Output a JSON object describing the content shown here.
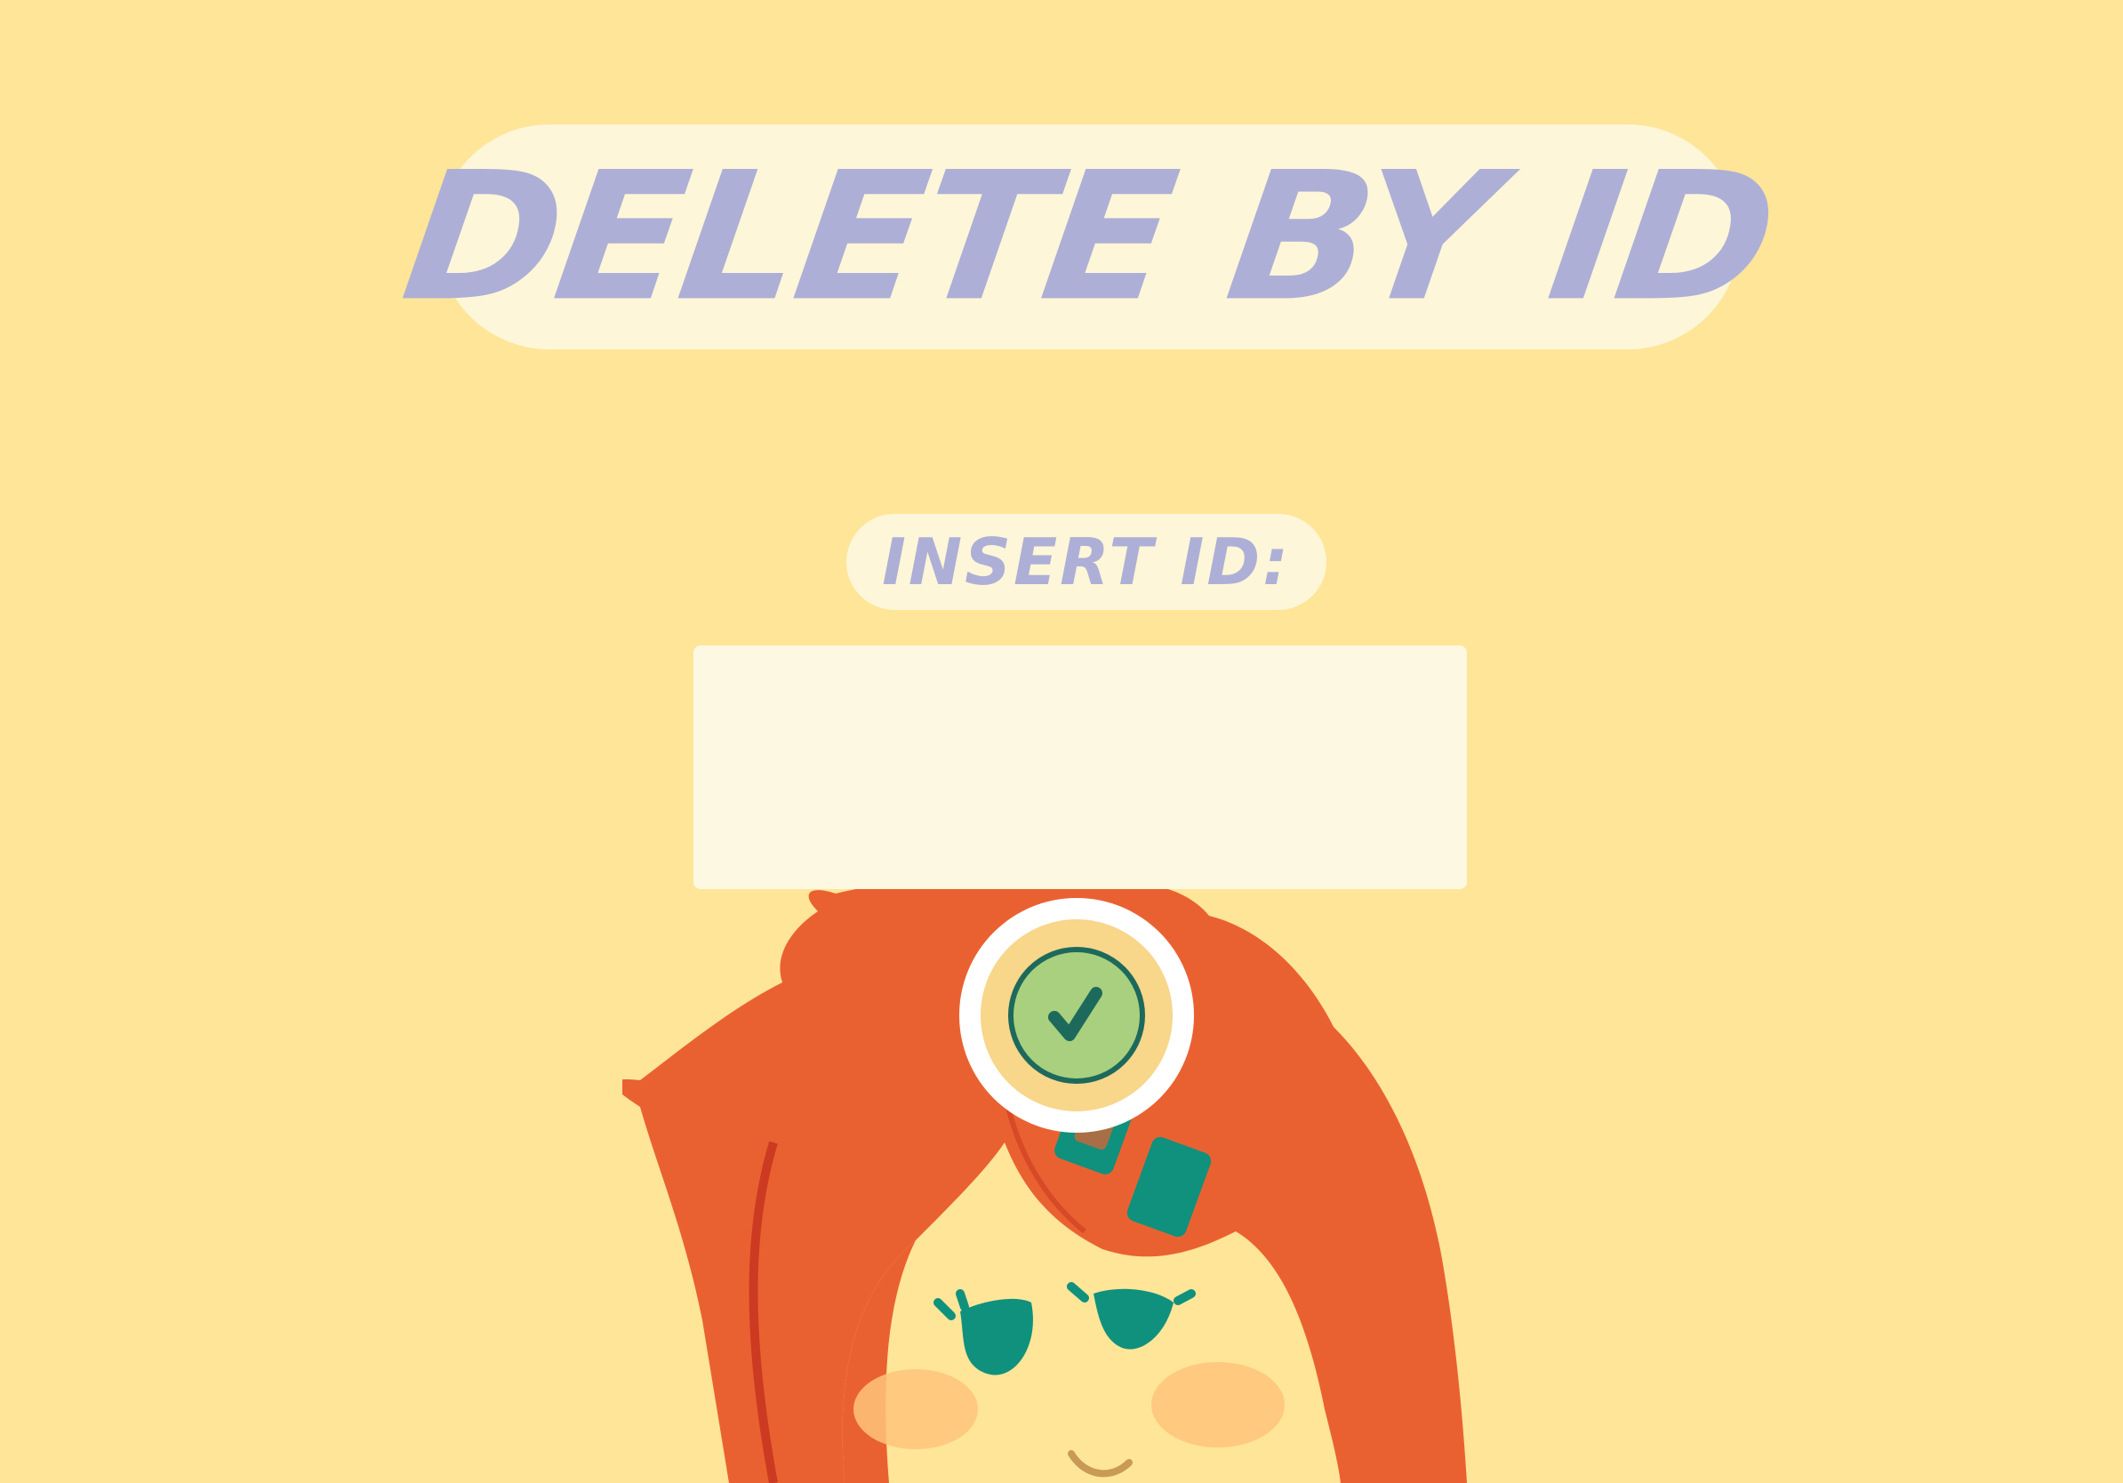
{
  "title": "DELETE BY ID",
  "form": {
    "label": "INSERT ID:",
    "id_value": "",
    "id_placeholder": ""
  },
  "confirm_button": {
    "icon": "check-icon"
  },
  "colors": {
    "background": "#fee598",
    "pill": "#fdf6d8",
    "text_lavender": "#adafd6",
    "input_bg": "#fdf8e1",
    "hair": "#ea6131",
    "check_green": "#a8d07e",
    "check_mark": "#1d6a5c",
    "clip_teal": "#0f917d"
  }
}
